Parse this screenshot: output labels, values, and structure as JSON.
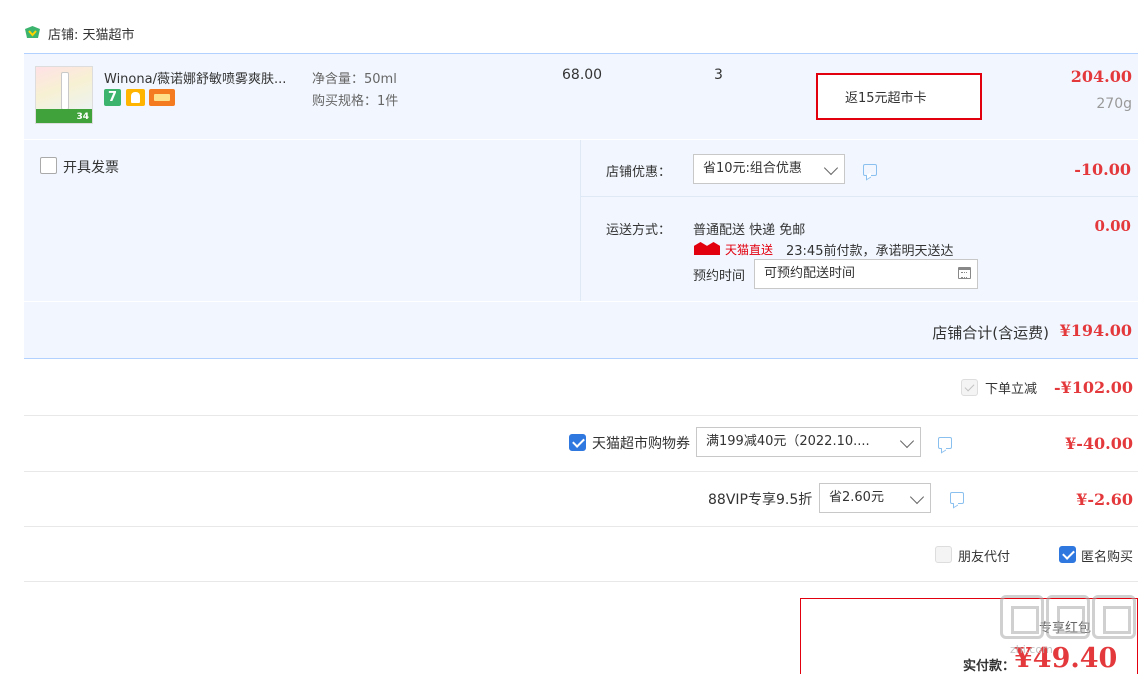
{
  "shop": {
    "label": "店铺: 天猫超市"
  },
  "item": {
    "title": "Winona/薇诺娜舒敏喷雾爽肤...",
    "tag_seven": "7",
    "thumb_num": "34",
    "spec_volume": "净含量：50ml",
    "spec_unit": "购买规格：1件",
    "unit_price": "68.00",
    "quantity": "3",
    "cashback": "返15元超市卡",
    "subtotal": "204.00",
    "weight": "270g"
  },
  "options": {
    "invoice_label": "开具发票",
    "coupon_label": "店铺优惠：",
    "coupon_value": "省10元:组合优惠",
    "coupon_amount": "-10.00",
    "shipping_label": "运送方式：",
    "shipping_type": "普通配送 快递 免邮",
    "tmall_direct": "天猫直送",
    "shipping_promise": "23:45前付款，承诺明天送达",
    "reserve_label": "预约时间",
    "reserve_placeholder": "可预约配送时间",
    "shipping_amount": "0.00"
  },
  "shop_total": {
    "label": "店铺合计(含运费)",
    "amount": "¥194.00"
  },
  "instant_discount": {
    "label": "下单立减",
    "amount": "-¥102.00",
    "checked": true
  },
  "tmall_coupon": {
    "label": "天猫超市购物券",
    "value": "满199减40元（2022.10....",
    "amount": "¥-40.00",
    "checked": true
  },
  "vip": {
    "label": "88VIP专享9.5折",
    "value": "省2.60元",
    "amount": "¥-2.60"
  },
  "friend_pay": {
    "label": "朋友代付",
    "checked": false
  },
  "anonymous": {
    "label": "匿名购买",
    "checked": true
  },
  "payment": {
    "sub_label": "专享红包",
    "label": "实付款：",
    "amount": "¥49.40"
  },
  "watermark": {
    "text": "zhi.com"
  },
  "colors": {
    "accent_red": "#e4393c",
    "border_red": "#e2000f",
    "checkbox_blue": "#2f78e0",
    "row_bg": "#f2f7ff"
  },
  "icons": [
    "shop-icon",
    "message-icon",
    "calendar-icon",
    "chevron-down-icon",
    "checkbox-icon"
  ]
}
